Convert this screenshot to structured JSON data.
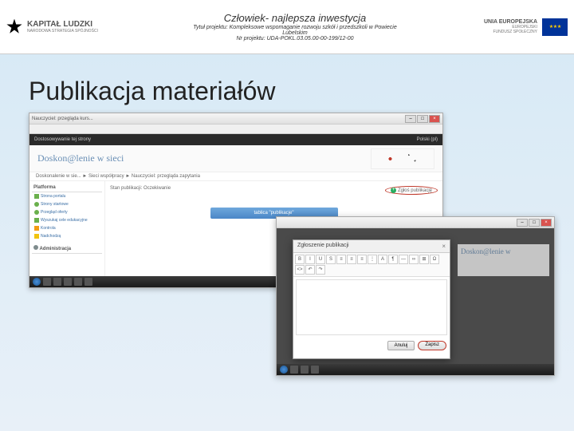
{
  "header": {
    "logo_main": "KAPITAŁ LUDZKI",
    "logo_sub": "NARODOWA STRATEGIA SPÓJNOŚCI",
    "motto": "Człowiek- najlepsza inwestycja",
    "project_title": "Tytuł projektu: Kompleksowe wspomaganie rozwoju szkół i przedszkoli w Powiecie",
    "project_sub": "Lubelskim",
    "project_no": "Nr projektu: UDA-POKL.03.05.00-00-199/12-00",
    "eu_main": "UNIA EUROPEJSKA",
    "eu_sub1": "EUROPEJSKI",
    "eu_sub2": "FUNDUSZ SPOŁECZNY"
  },
  "main_heading": "Publikacja materiałów",
  "screenshot1": {
    "window_title": "Nauczyciel: przegląda kurs...",
    "moodle_nav_left": "Dostosowywanie tej strony",
    "moodle_nav_right": "Polski (pl)",
    "banner_text": "Doskon@lenie w sieci",
    "breadcrumb": "Doskonalenie w sie... ► Sieci współpracy ► Nauczyciel: przegląda zapytania",
    "sidebar_title": "Platforma",
    "sidebar_items": [
      "Strona portalu",
      "Strony startowe",
      "Przegląd oferty",
      "Wyszukaj cele edukacyjne",
      "Kontrola",
      "Nadchodzą"
    ],
    "admin_title": "Administracja",
    "panel_label": "Stan publikacji",
    "panel_status": "Oczekiwanie",
    "add_button": "Zgłoś publikację",
    "blue_button": "tablica \"publikacje\""
  },
  "screenshot2": {
    "banner_text": "Doskon@lenie w",
    "modal_title": "Zgłoszenie publikacji",
    "editor_buttons": [
      "B",
      "I",
      "U",
      "S",
      "≡",
      "≡",
      "≡",
      "⋮",
      "A",
      "¶",
      "—",
      "∞",
      "⊞",
      "Ω",
      "<>",
      "↶",
      "↷"
    ],
    "cancel_label": "Anuluj",
    "submit_label": "Zapisz"
  }
}
